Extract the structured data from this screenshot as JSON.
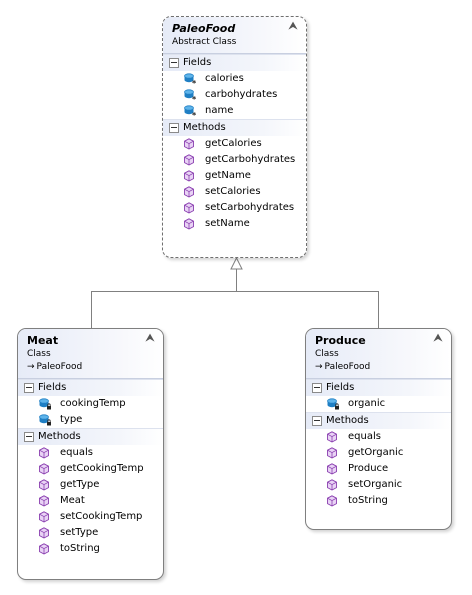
{
  "diagram": {
    "classes": [
      {
        "id": "paleofood",
        "name": "PaleoFood",
        "kind": "Abstract Class",
        "base": "",
        "fields_label": "Fields",
        "methods_label": "Methods",
        "fields": [
          {
            "name": "calories",
            "icon": "protected-field-icon"
          },
          {
            "name": "carbohydrates",
            "icon": "protected-field-icon"
          },
          {
            "name": "name",
            "icon": "protected-field-icon"
          }
        ],
        "methods": [
          "getCalories",
          "getCarbohydrates",
          "getName",
          "setCalories",
          "setCarbohydrates",
          "setName"
        ]
      },
      {
        "id": "meat",
        "name": "Meat",
        "kind": "Class",
        "base": "PaleoFood",
        "fields_label": "Fields",
        "methods_label": "Methods",
        "fields": [
          {
            "name": "cookingTemp",
            "icon": "private-field-icon"
          },
          {
            "name": "type",
            "icon": "private-field-icon"
          }
        ],
        "methods": [
          "equals",
          "getCookingTemp",
          "getType",
          "Meat",
          "setCookingTemp",
          "setType",
          "toString"
        ]
      },
      {
        "id": "produce",
        "name": "Produce",
        "kind": "Class",
        "base": "PaleoFood",
        "fields_label": "Fields",
        "methods_label": "Methods",
        "fields": [
          {
            "name": "organic",
            "icon": "private-field-icon"
          }
        ],
        "methods": [
          "equals",
          "getOrganic",
          "Produce",
          "setOrganic",
          "toString"
        ]
      }
    ],
    "colors": {
      "field_icon": "#1f7fc4",
      "method_icon": "#8a3fb0",
      "header_gradient": "#e6ebf7",
      "border": "#7f7f7f"
    }
  }
}
